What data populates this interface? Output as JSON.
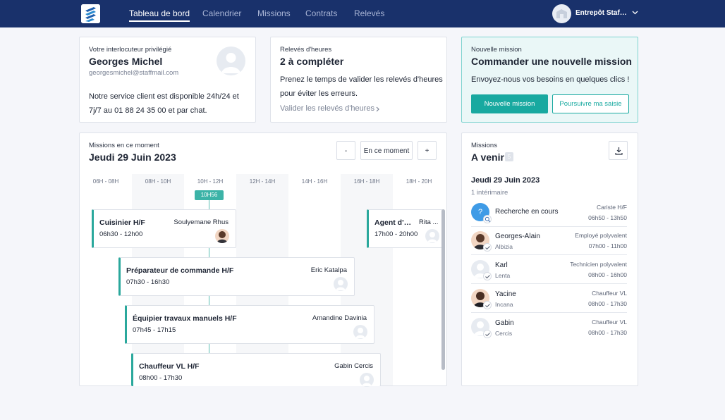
{
  "nav": {
    "items": [
      "Tableau de bord",
      "Calendrier",
      "Missions",
      "Contrats",
      "Relevés"
    ],
    "account_name": "Entrepôt Staffme..."
  },
  "contact": {
    "label": "Votre interlocuteur privilégié",
    "name": "Georges Michel",
    "email": "georgesmichel@staffmail.com",
    "service_line1": "Notre service client est disponible 24h/24 et",
    "service_line2": "7j/7 au 01 88 24 35 00 et par chat."
  },
  "timesheets": {
    "label": "Relevés d'heures",
    "title": "2 à compléter",
    "line1": "Prenez le temps de valider les relevés d'heures",
    "line2": "pour éviter les erreurs.",
    "link": "Valider les relevés d'heures"
  },
  "new_mission": {
    "label": "Nouvelle mission",
    "title": "Commander une nouvelle mission",
    "text": "Envoyez-nous vos besoins en quelques clics !",
    "primary_btn": "Nouvelle mission",
    "secondary_btn": "Poursuivre ma saisie"
  },
  "current": {
    "label": "Missions en ce moment",
    "date": "Jeudi 29 Juin 2023",
    "minus": "-",
    "now_btn": "En ce moment",
    "plus": "+",
    "time_headers": [
      "06H - 08H",
      "08H - 10H",
      "10H - 12H",
      "12H - 14H",
      "14H - 16H",
      "16H - 18H",
      "18H - 20H"
    ],
    "now_label": "10H56",
    "shifts": [
      {
        "title": "Cuisinier H/F",
        "time": "06h30 - 12h00",
        "name": "Soulyemane Rhus"
      },
      {
        "title": "Agent d'e...",
        "time": "17h00 - 20h00",
        "name": "Rita ..."
      },
      {
        "title": "Préparateur de commande H/F",
        "time": "07h30 - 16h30",
        "name": "Eric Katalpa"
      },
      {
        "title": "Équipier travaux manuels H/F",
        "time": "07h45 - 17h15",
        "name": "Amandine Davinia"
      },
      {
        "title": "Chauffeur VL H/F",
        "time": "08h00 - 17h30",
        "name": "Gabin Cercis"
      }
    ]
  },
  "upcoming": {
    "label": "Missions",
    "title": "A venir",
    "count": "5",
    "date": "Jeudi 29 Juin 2023",
    "sub": "1 intérimaire",
    "rows": [
      {
        "name": "Recherche en cours",
        "sub": "",
        "role": "Cariste H/F",
        "time": "06h50 - 13h50",
        "avatar": "?"
      },
      {
        "name": "Georges-Alain",
        "sub": "Albizia",
        "role": "Employé polyvalent",
        "time": "07h00 - 11h00"
      },
      {
        "name": "Karl",
        "sub": "Lenta",
        "role": "Technicien polyvalent",
        "time": "08h00 - 16h00"
      },
      {
        "name": "Yacine",
        "sub": "Incana",
        "role": "Chauffeur VL",
        "time": "08h00 - 17h30"
      },
      {
        "name": "Gabin",
        "sub": "Cercis",
        "role": "Chauffeur VL",
        "time": "08h00 - 17h30"
      }
    ]
  },
  "colors": {
    "navy": "#19316b",
    "teal": "#18a9a0",
    "accent_line": "#2aa89c"
  }
}
